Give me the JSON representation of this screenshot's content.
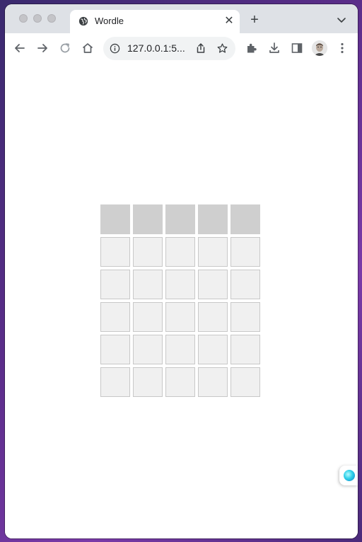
{
  "tab": {
    "title": "Wordle",
    "favicon": "globe-icon",
    "close_glyph": "✕"
  },
  "tabstrip": {
    "new_tab_glyph": "+"
  },
  "toolbar": {
    "url": "127.0.0.1:5...",
    "icons": [
      "back-arrow-icon",
      "forward-arrow-icon",
      "reload-icon",
      "home-icon",
      "info-icon",
      "share-icon",
      "star-icon",
      "extensions-icon",
      "download-icon",
      "side-panel-icon",
      "avatar",
      "kebab-menu-icon"
    ]
  },
  "board": {
    "rows": [
      [
        "",
        "",
        "",
        "",
        ""
      ],
      [
        "",
        "",
        "",
        "",
        ""
      ],
      [
        "",
        "",
        "",
        "",
        ""
      ],
      [
        "",
        "",
        "",
        "",
        ""
      ],
      [
        "",
        "",
        "",
        "",
        ""
      ],
      [
        "",
        "",
        "",
        "",
        ""
      ]
    ],
    "active_row": 0
  },
  "colors": {
    "tile_empty": "#f0f0f0",
    "tile_active": "#cfcfcf",
    "tile_border": "#c8c8c8",
    "chrome_tabstrip": "#dee1e6"
  }
}
